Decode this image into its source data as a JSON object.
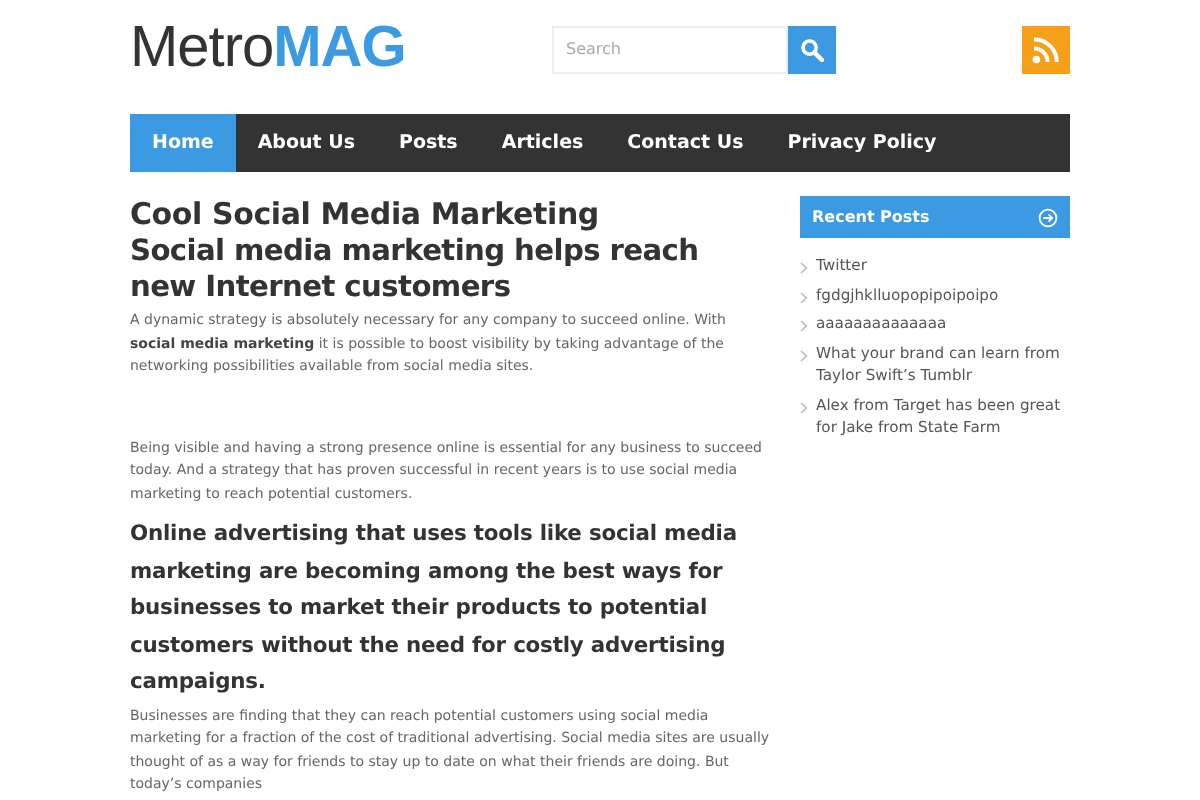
{
  "logo": {
    "light": "Metro",
    "bold": "MAG"
  },
  "search": {
    "placeholder": "Search"
  },
  "nav": [
    {
      "label": "Home",
      "selected": true
    },
    {
      "label": "About Us",
      "selected": false
    },
    {
      "label": "Posts",
      "selected": false
    },
    {
      "label": "Articles",
      "selected": false
    },
    {
      "label": "Contact Us",
      "selected": false
    },
    {
      "label": "Privacy Policy",
      "selected": false
    }
  ],
  "article": {
    "title": "Cool Social Media Marketing",
    "subtitle": "Social media marketing helps reach new Internet customers",
    "blocks": [
      {
        "kind": "paragraph",
        "text": "A dynamic strategy is absolutely necessary for any company to succeed online. With **social media marketing** it is possible to boost visibility by taking advantage of the networking possibilities available from social media sites."
      },
      {
        "kind": "spacer"
      },
      {
        "kind": "paragraph",
        "text": "Being visible and having a strong presence online is essential for any business to succeed today. And a strategy that has proven successful in recent years is to use social media marketing to reach potential customers."
      },
      {
        "kind": "heading",
        "text": "Online advertising that uses tools like social media marketing are becoming among the best ways for businesses to market their products to potential customers without the need for costly advertising campaigns."
      },
      {
        "kind": "paragraph",
        "text": "Businesses are finding that they can reach potential customers using social media marketing for a fraction of the cost of traditional advertising. Social media sites are usually thought of as a way for friends to stay up to date on what their friends are doing. But today’s companies"
      }
    ]
  },
  "sidebar": {
    "title": "Recent Posts",
    "posts": [
      "Twitter",
      "fgdgjhklluopopipoipoipo",
      "aaaaaaaaaaaaaa",
      "What your brand can learn from Taylor Swift’s Tumblr",
      "Alex from Target has been great for Jake from State Farm"
    ]
  }
}
